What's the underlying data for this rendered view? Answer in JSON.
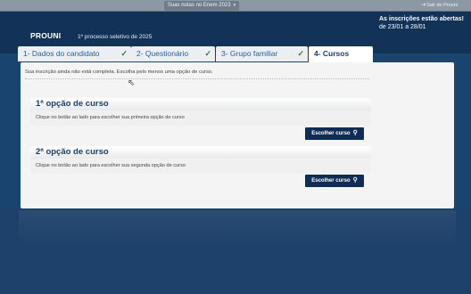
{
  "topbar": {
    "notas_label": "Suas notas no Enem 2023",
    "notas_chevron": "▾",
    "sair_label": "Sair do Prouni",
    "sair_icon": "exit-icon"
  },
  "header": {
    "brand": "PROUNI",
    "processo": "1º processo seletivo de 2025",
    "inscricoes_line1": "As inscrições estão abertas!",
    "inscricoes_line2": "de 23/01 a 28/01"
  },
  "tabs": [
    {
      "label": "1- Dados do candidato",
      "check": "✓"
    },
    {
      "label": "2- Questionário",
      "check": "✓"
    },
    {
      "label": "3- Grupo familiar",
      "check": "✓"
    },
    {
      "label": "4- Cursos"
    }
  ],
  "main": {
    "aviso": "Sua inscrição ainda não está completa. Escolha pelo menos uma opção de curso.",
    "opcoes": [
      {
        "titulo": "1ª opção de curso",
        "descricao": "Clique no botão ao lado para escolher sua primeira opção de curso",
        "botao": "Escolher curso"
      },
      {
        "titulo": "2ª opção de curso",
        "descricao": "Clique no botão ao lado para escolher sua segunda opção de curso",
        "botao": "Escolher curso"
      }
    ]
  },
  "colors": {
    "header_bg": "#123257",
    "tab_text": "#2a5d99",
    "button_bg": "#0f2c55",
    "check": "#3a7a2c"
  }
}
